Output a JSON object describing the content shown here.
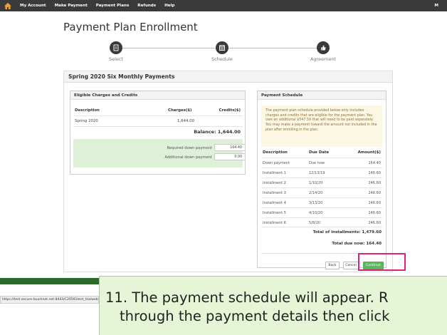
{
  "nav": {
    "home_icon": "home-icon",
    "items": [
      "My Account",
      "Make Payment",
      "Payment Plans",
      "Refunds",
      "Help"
    ],
    "user_initial": "M"
  },
  "page": {
    "title": "Payment Plan Enrollment"
  },
  "steps": [
    {
      "label": "Select",
      "icon": "document-icon"
    },
    {
      "label": "Schedule",
      "icon": "calendar-icon"
    },
    {
      "label": "Agreement",
      "icon": "thumbs-up-icon"
    }
  ],
  "plan": {
    "title": "Spring 2020 Six Monthly Payments"
  },
  "charges": {
    "title": "Eligible Charges and Credits",
    "headers": [
      "Description",
      "Charges($)",
      "Credits($)"
    ],
    "rows": [
      {
        "description": "Spring 2020",
        "charges": "1,644.00",
        "credits": ""
      }
    ],
    "balance": "Balance: 1,644.00",
    "required_label": "Required down payment",
    "required_value": "164.40",
    "additional_label": "Additional down payment",
    "additional_value": "0.00"
  },
  "schedule": {
    "title": "Payment Schedule",
    "notice": "The payment plan schedule provided below only includes charges and credits that are eligible for the payment plan. You owe an additional $547.50 that will need to be paid separately. You may make a payment toward the amount not included in the plan after enrolling in the plan.",
    "headers": [
      "Description",
      "Due Date",
      "Amount($)"
    ],
    "rows": [
      {
        "description": "Down payment",
        "due": "Due now",
        "amount": "164.40"
      },
      {
        "description": "Installment 1",
        "due": "12/13/19",
        "amount": "246.60"
      },
      {
        "description": "Installment 2",
        "due": "1/10/20",
        "amount": "246.60"
      },
      {
        "description": "Installment 3",
        "due": "2/14/20",
        "amount": "246.60"
      },
      {
        "description": "Installment 4",
        "due": "3/13/20",
        "amount": "246.60"
      },
      {
        "description": "Installment 5",
        "due": "4/10/20",
        "amount": "246.60"
      },
      {
        "description": "Installment 6",
        "due": "5/8/20",
        "amount": "246.60"
      }
    ],
    "total_installments": "Total of installments: 1,479.60",
    "total_due": "Total due now: 164.40"
  },
  "buttons": {
    "back": "Back",
    "cancel": "Cancel",
    "continue": "Continue"
  },
  "status_url": "https://test.secure.touchnet.net:8443/C20591test_tsa/web/paymentplan/...",
  "callout": {
    "line1": "11. The payment schedule will appear. R",
    "line2": "through the payment details then click"
  },
  "colors": {
    "topbar": "#3a3a3a",
    "accent_green": "#5cb85c",
    "highlight": "#e0217a",
    "callout_bg": "#e6f5d6",
    "notice_bg": "#fcf8e3"
  }
}
